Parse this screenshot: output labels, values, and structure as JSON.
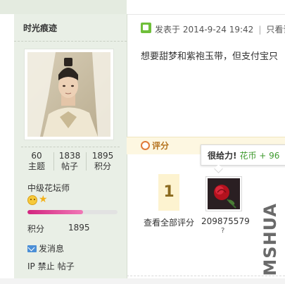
{
  "author": {
    "name": "时光痕迹",
    "stats": [
      {
        "value": "60",
        "label": "主题"
      },
      {
        "value": "1838",
        "label": "帖子"
      },
      {
        "value": "1895",
        "label": "积分"
      }
    ],
    "user_title": "中级花坛师",
    "level_progress": 0.62,
    "points_label": "积分",
    "points_value": "1895",
    "send_message": "发消息",
    "ip_ban": "IP",
    "ban_label": "禁止",
    "posts_label": "帖子"
  },
  "post": {
    "posted_at": "发表于 2014-9-24 19:42",
    "divider": "|",
    "view_prefix": "只看该",
    "text": "想要甜梦和紫袍玉带，但支付宝只"
  },
  "rating": {
    "title": "评分",
    "count": "1",
    "view_all": "查看全部评分",
    "rater_name": "209875579",
    "rater_name_tail": "?"
  },
  "tooltip": {
    "bold": "很给力!",
    "reward": "花币 + 96"
  },
  "watermark": "MSHUA",
  "colors": {
    "sidebar_bg": "#e9efe6",
    "rate_bar_bg": "#fdf7e1",
    "rate_title": "#b5731e",
    "level_fill": "#d2257f",
    "reward_green": "#3f9a2e"
  },
  "icons": {
    "post": "post-icon",
    "rate": "rate-circle-icon",
    "mail": "mail-icon",
    "medal_face": "smiley-medal-icon",
    "medal_star": "star-medal-icon"
  }
}
